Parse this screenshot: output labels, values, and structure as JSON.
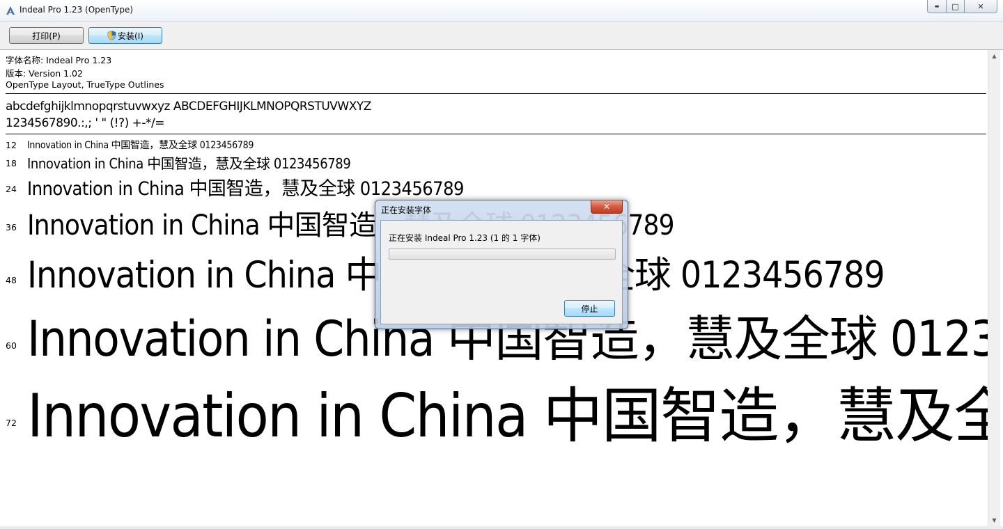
{
  "window": {
    "title": "Indeal Pro 1.23 (OpenType)",
    "minimize_glyph": "▬",
    "maximize_glyph": "□",
    "close_glyph": "✕"
  },
  "toolbar": {
    "print_label": "打印(P)",
    "install_label": "安装(I)"
  },
  "font_info": {
    "name_line": "字体名称: Indeal Pro 1.23",
    "version_line": "版本: Version 1.02",
    "format_line": "OpenType Layout, TrueType Outlines"
  },
  "charset": {
    "letters": "abcdefghijklmnopqrstuvwxyz ABCDEFGHIJKLMNOPQRSTUVWXYZ",
    "digits": "1234567890.:,; ' \" (!?) +-*/="
  },
  "samples": {
    "text": "Innovation in China 中国智造，慧及全球 0123456789",
    "sizes": [
      "12",
      "18",
      "24",
      "36",
      "48",
      "60",
      "72"
    ]
  },
  "dialog": {
    "title": "正在安装字体",
    "close_glyph": "✕",
    "message": "正在安装 Indeal Pro 1.23 (1 的 1 字体)",
    "progress": 0.0,
    "stop_label": "停止"
  },
  "scrollbar": {
    "up_glyph": "▲",
    "down_glyph": "▼"
  },
  "colors": {
    "accent_button_border": "#3c7fb1",
    "dialog_close": "#c43a1f"
  }
}
